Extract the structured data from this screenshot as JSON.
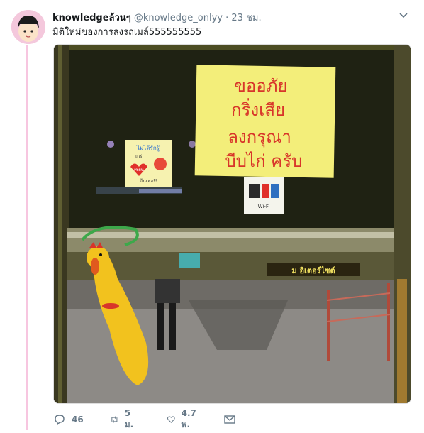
{
  "tweet": {
    "display_name": "knowledgeล้วนๆ",
    "handle": "@knowledge_onlyy",
    "separator": "·",
    "time": "23 ชม.",
    "text": "มิติใหม่ของการลงรถเมล์555555555"
  },
  "photo": {
    "sign_main": [
      "ขออภัย",
      "กริ่งเสีย",
      "ลงกรุณา",
      "บีบไก่ ครับ"
    ],
    "sticker_top": "ไม่ได้รักรู้",
    "sticker_mid": "แค่...",
    "sticker_heart": "เซียน",
    "sticker_bottom": "มันเฮง!!",
    "wifi_label": "Wi-Fi",
    "bus_brand": "ม อิเตอร์ไซต์"
  },
  "actions": {
    "reply_count": "46",
    "retweet_count": "5 ม.",
    "like_count": "4.7 พ."
  },
  "colors": {
    "accent_pink": "#f7c6e0",
    "muted": "#657786",
    "sign_yellow": "#f3ee7a",
    "sign_red": "#d8352a"
  }
}
